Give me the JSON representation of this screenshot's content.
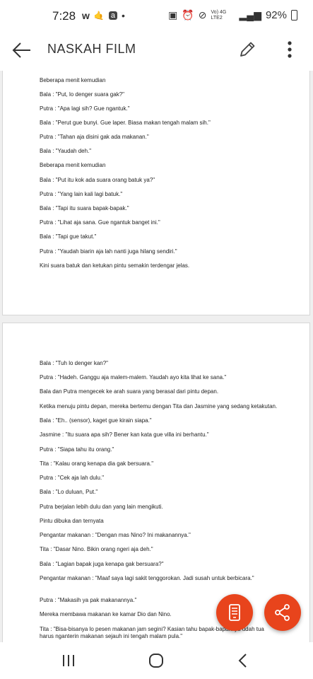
{
  "status_bar": {
    "time": "7:28",
    "app_badges": [
      "w",
      "🤙",
      "a"
    ],
    "network": "Vo) 4G LTE2",
    "battery": "92%"
  },
  "app_bar": {
    "title": "NASKAH FILM"
  },
  "page1": {
    "lines": [
      "Beberapa menit kemudian",
      "Bala : \"Put, lo denger suara gak?\"",
      "Putra : \"Apa lagi sih? Gue ngantuk.\"",
      "Bala : \"Perut gue bunyi. Gue laper. Biasa makan tengah malam sih.\"",
      "Putra : \"Tahan aja disini gak ada makanan.\"",
      "Bala : \"Yaudah deh.\"",
      "Beberapa menit kemudian",
      "Bala : \"Put itu kok ada suara orang batuk ya?\"",
      "Putra : \"Yang lain kali lagi batuk.\"",
      "Bala : \"Tapi itu suara bapak-bapak.\"",
      "Putra : \"Lihat aja sana. Gue ngantuk banget ini.\"",
      "Bala : \"Tapi gue takut.\"",
      "Putra : \"Yaudah biarin aja lah nanti juga hilang sendiri.\"",
      "Kini suara batuk dan ketukan pintu semakin terdengar jelas."
    ]
  },
  "page2": {
    "lines": [
      "Bala : \"Tuh lo denger kan?\"",
      "Putra : \"Hadeh. Ganggu aja malem-malem. Yaudah ayo kita lihat ke sana.\"",
      "Bala dan Putra mengecek ke arah suara yang berasal dari pintu depan.",
      "Ketika menuju pintu depan, mereka bertemu dengan Tita dan Jasmine yang sedang ketakutan.",
      "Bala : \"Eh.. (sensor), kaget gue kirain siapa.\"",
      "Jasmine : \"Itu suara apa sih? Bener kan kata gue villa ini berhantu.\"",
      "Putra : \"Siapa tahu itu orang.\"",
      "Tita : \"Kalau orang kenapa dia gak bersuara.\"",
      "Putra : \"Cek aja lah dulu.\"",
      "Bala : \"Lo duluan, Put.\"",
      "Putra berjalan lebih dulu dan yang lain mengikuti.",
      "Pintu dibuka dan ternyata",
      "Pengantar makanan : \"Dengan mas Nino? Ini makanannya.\"",
      "Tita : \"Dasar Nino. Bikin orang ngeri aja deh.\"",
      "Bala : \"Lagian bapak juga kenapa gak bersuara?\"",
      "Pengantar makanan : \"Maaf saya lagi sakit tenggorokan. Jadi susah untuk berbicara.\"",
      "Putra : \"Makasih ya pak makanannya.\"",
      "Mereka membawa makanan ke kamar Dio dan Nino.",
      "Tita : \"Bisa-bisanya lo pesen makanan jam segini? Kasian tahu bapak-bapaknya udah tua harus nganterin makanan sejauh ini tengah malam pula.\""
    ]
  }
}
